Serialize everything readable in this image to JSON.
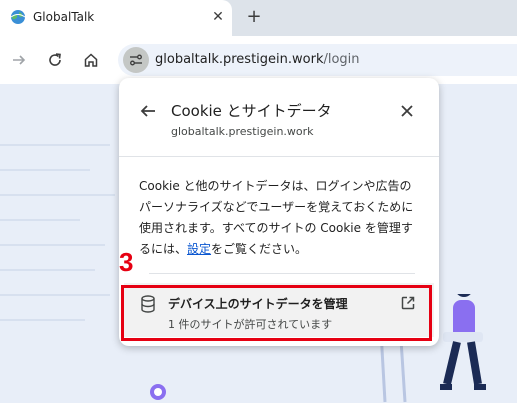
{
  "tab": {
    "title": "GlobalTalk",
    "close_glyph": "✕",
    "new_tab_glyph": "+"
  },
  "toolbar": {
    "url_host": "globaltalk.prestigein.work",
    "url_path": "/login"
  },
  "popup": {
    "title": "Cookie とサイトデータ",
    "subtitle": "globaltalk.prestigein.work",
    "description_before": "Cookie と他のサイトデータは、ログインや広告のパーソナライズなどでユーザーを覚えておくために使用されます。すべてのサイトの Cookie を管理するには、",
    "description_link": "設定",
    "description_after": "をご覧ください。",
    "row": {
      "title": "デバイス上のサイトデータを管理",
      "subtitle": "1 件のサイトが許可されています"
    }
  },
  "annotation": {
    "step_number": "3",
    "color": "#e60012"
  },
  "icons": [
    "globe-favicon-icon",
    "close-icon",
    "plus-icon",
    "forward-arrow-icon",
    "reload-icon",
    "home-icon",
    "site-settings-icon",
    "back-arrow-icon",
    "database-icon",
    "open-external-icon"
  ]
}
